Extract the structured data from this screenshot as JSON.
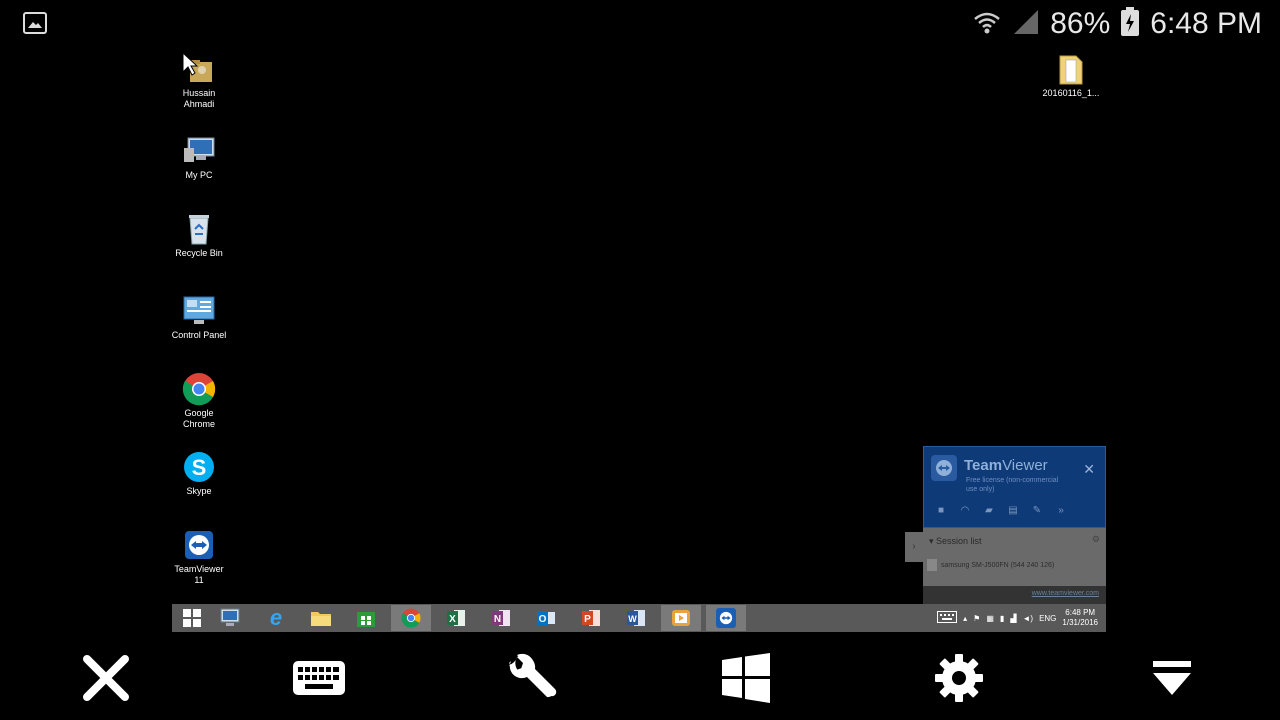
{
  "status_bar": {
    "battery": "86%",
    "time": "6:48 PM"
  },
  "desktop": {
    "icons": [
      {
        "label": "Hussain Ahmadi",
        "icon": "user-folder-icon"
      },
      {
        "label": "My PC",
        "icon": "computer-icon"
      },
      {
        "label": "Recycle Bin",
        "icon": "recycle-bin-icon"
      },
      {
        "label": "Control Panel",
        "icon": "control-panel-icon"
      },
      {
        "label": "Google Chrome",
        "icon": "chrome-icon"
      },
      {
        "label": "Skype",
        "icon": "skype-icon"
      },
      {
        "label": "TeamViewer 11",
        "icon": "teamviewer-icon"
      }
    ],
    "right_icon": {
      "label": "20160116_1...",
      "icon": "folder-icon"
    }
  },
  "taskbar": {
    "apps": [
      "start-icon",
      "this-pc-icon",
      "internet-explorer-icon",
      "file-explorer-icon",
      "store-icon",
      "chrome-icon",
      "excel-icon",
      "onenote-icon",
      "outlook-icon",
      "powerpoint-icon",
      "word-icon",
      "media-player-icon",
      "teamviewer-icon"
    ],
    "language": "ENG",
    "clock_time": "6:48 PM",
    "clock_date": "1/31/2016"
  },
  "teamviewer": {
    "title_bold": "Team",
    "title_rest": "Viewer",
    "subtitle": "Free license (non-commercial use only)",
    "session_list": "Session list",
    "session_item": "samsung SM-J500FN (544 240 126)",
    "link": "www.teamviewer.com"
  },
  "toolbar": {
    "buttons": [
      "close-icon",
      "keyboard-icon",
      "wrench-icon",
      "windows-icon",
      "settings-icon",
      "hide-toolbar-icon"
    ]
  },
  "colors": {
    "tv_header": "#0e3a78",
    "taskbar": "#595959"
  }
}
